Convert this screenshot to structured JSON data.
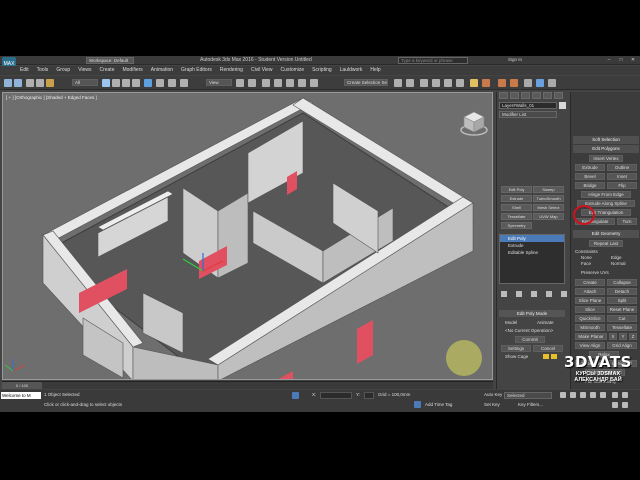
{
  "app": {
    "title": "Autodesk 3ds Max 2016 - Student Version    Untitled",
    "workspace": "Workspace: Default",
    "search_placeholder": "Type a keyword or phrase",
    "sign_in": "Sign In",
    "window_buttons": [
      "–",
      "□",
      "✕"
    ]
  },
  "menu": [
    "Edit",
    "Tools",
    "Group",
    "Views",
    "Create",
    "Modifiers",
    "Animation",
    "Graph Editors",
    "Rendering",
    "Civil View",
    "Customize",
    "Scripting",
    "Lauldwork",
    "Help"
  ],
  "toolbar": {
    "filter_all": "All",
    "view_dropdown": "View",
    "create_selection_set": "Create Selection Se"
  },
  "viewport": {
    "label": "[ + ] [Orthographic ] [Shaded + Edged Faces ]"
  },
  "timeline": {
    "frame": "0 / 100"
  },
  "status": {
    "maxscript": "Welcome to M",
    "objects_selected": "1 Object Selected",
    "prompt": "Click or click-and-drag to select objects",
    "x_label": "X:",
    "y_label": "Y:",
    "z_label": "Z:",
    "grid": "Grid = 100,0mm",
    "add_time_tag": "Add Time Tag",
    "auto_key": "Auto Key",
    "selected": "Selected",
    "set_key": "Set Key",
    "key_filters": "Key Filters..."
  },
  "command_panel": {
    "object_name": "Layer#Walls_01",
    "modifier_list": "Modifier List",
    "buttons": [
      [
        "Edit Poly",
        "Sweep"
      ],
      [
        "Extrude",
        "TurboSmooth"
      ],
      [
        "Shell",
        "Mesh Select"
      ],
      [
        "Tessellate",
        "UVW Map"
      ],
      [
        "Symmetry",
        ""
      ]
    ],
    "stack": [
      {
        "label": "Edit Poly",
        "selected": true
      },
      {
        "label": "Extrude",
        "selected": false
      },
      {
        "label": "Editable Spline",
        "selected": false
      }
    ],
    "edit_poly_mode": {
      "title": "Edit Poly Mode",
      "model": "Model",
      "animate": "Animate",
      "no_current_operation": "<No Current Operation>",
      "commit": "Commit",
      "settings": "Settings",
      "cancel": "Cancel",
      "show_cage": "Show Cage"
    }
  },
  "ribbon": {
    "soft_selection": "Soft Selection",
    "edit_polygons": "Edit Polygons",
    "insert_vertex": "Insert Vertex",
    "rows": [
      [
        "Extrude",
        "Outline"
      ],
      [
        "Bevel",
        "Inset"
      ],
      [
        "Bridge",
        "Flip"
      ]
    ],
    "hinge_from_edge": "Hinge From Edge",
    "extrude_along_spline": "Extrude Along Spline",
    "edit_triangulation": "Edit Triangulation",
    "retriangulate": "Retriangulate",
    "turn": "Turn",
    "edit_geometry": "Edit Geometry",
    "repeat_last": "Repeat Last",
    "constraints": "Constraints",
    "none": "None",
    "edge": "Edge",
    "face": "Face",
    "normal": "Normal",
    "preserve_uvs": "Preserve UVs",
    "geo_rows": [
      [
        "Create",
        "Collapse"
      ],
      [
        "Attach",
        "Detach"
      ],
      [
        "Slice Plane",
        "Split"
      ],
      [
        "Slice",
        "Reset Plane"
      ],
      [
        "QuickSlice",
        "Cut"
      ],
      [
        "MSmooth",
        "Tessellate"
      ]
    ],
    "make_planar": "Make Planar",
    "xyz": [
      "X",
      "Y",
      "Z"
    ],
    "view_align": "View Align",
    "grid_align": "Grid Align",
    "relax": "Relax",
    "hide_selected": "Hide Selected",
    "unhide_all": "Unhide All",
    "hide_unselected": "Hide Unselected",
    "full_interactivity": "Full Interactivity"
  },
  "watermark": {
    "brand": "3DVATS",
    "line1": "КУРСЫ 3DSMAX",
    "line2": "АЛЕКСАНДР БАЙ"
  },
  "colors": {
    "walls": "#d2d2d2",
    "openings": "#e05060",
    "viewport_bg": "#6e6e6e",
    "selection": "#4a7ab8",
    "highlight": "#d0121f"
  }
}
